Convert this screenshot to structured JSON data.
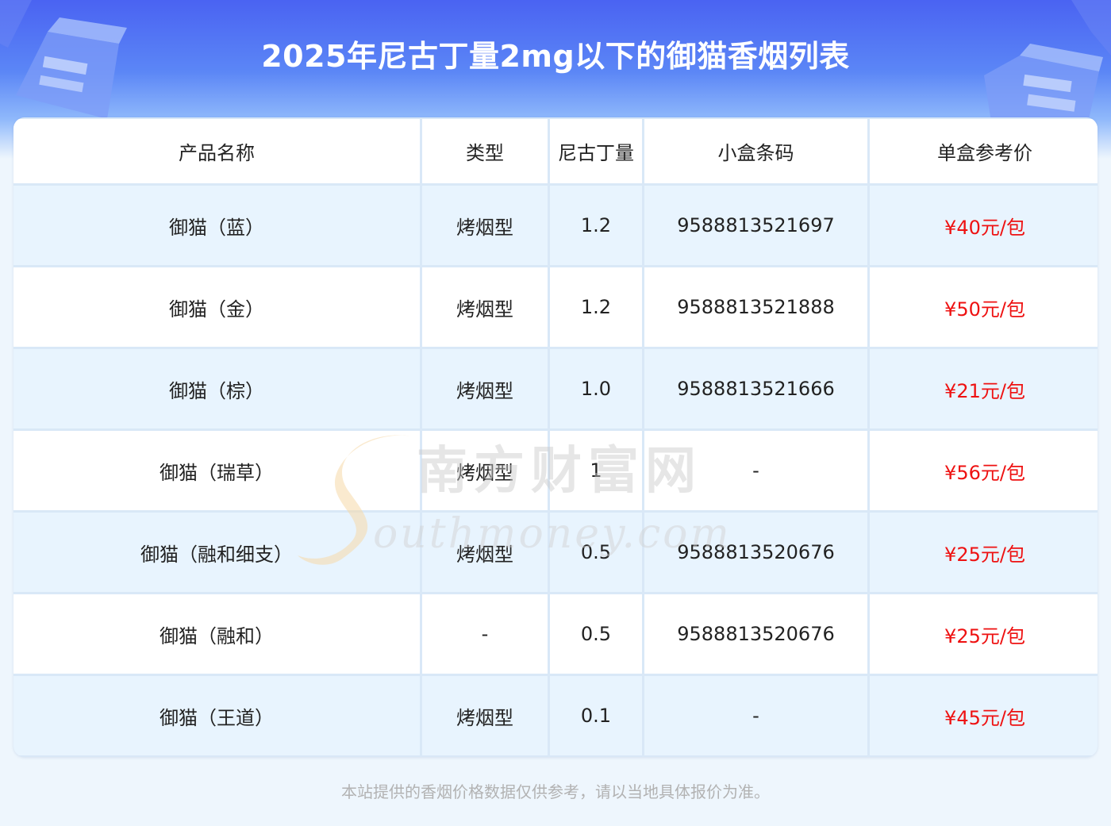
{
  "title": "2025年尼古丁量2mg以下的御猫香烟列表",
  "colors": {
    "price": "#ee1111",
    "header_blue": "#4a63f2",
    "row_alt": "#e8f4fe"
  },
  "table": {
    "headers": [
      "产品名称",
      "类型",
      "尼古丁量",
      "小盒条码",
      "单盒参考价"
    ],
    "rows": [
      [
        "御猫（蓝）",
        "烤烟型",
        "1.2",
        "9588813521697",
        "¥40元/包"
      ],
      [
        "御猫（金）",
        "烤烟型",
        "1.2",
        "9588813521888",
        "¥50元/包"
      ],
      [
        "御猫（棕）",
        "烤烟型",
        "1.0",
        "9588813521666",
        "¥21元/包"
      ],
      [
        "御猫（瑞草）",
        "烤烟型",
        "1",
        "-",
        "¥56元/包"
      ],
      [
        "御猫（融和细支）",
        "烤烟型",
        "0.5",
        "9588813520676",
        "¥25元/包"
      ],
      [
        "御猫（融和）",
        "-",
        "0.5",
        "9588813520676",
        "¥25元/包"
      ],
      [
        "御猫（王道）",
        "烤烟型",
        "0.1",
        "-",
        "¥45元/包"
      ]
    ]
  },
  "watermark": {
    "line1": "南方财富网",
    "line2": "outhmoney.com"
  },
  "footer": "本站提供的香烟价格数据仅供参考，请以当地具体报价为准。"
}
